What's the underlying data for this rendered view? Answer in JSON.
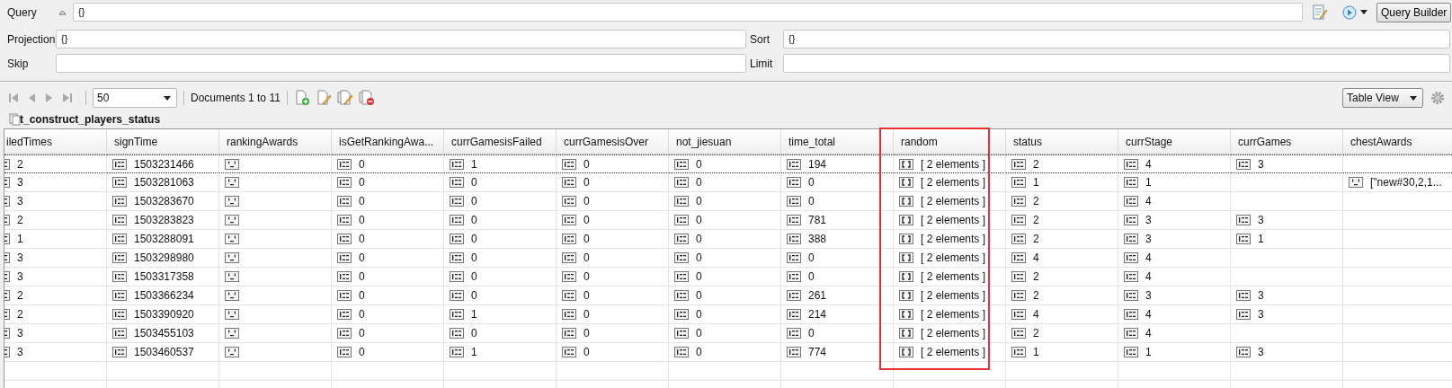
{
  "query": {
    "label": "Query",
    "value": "{}",
    "button": "Query Builder"
  },
  "projection": {
    "label": "Projection",
    "value": "{}"
  },
  "sort": {
    "label": "Sort",
    "value": "{}"
  },
  "skip": {
    "label": "Skip"
  },
  "limit": {
    "label": "Limit"
  },
  "toolbar": {
    "page_size": "50",
    "documents": "Documents 1 to 11",
    "view": "Table View"
  },
  "collection": "t_construct_players_status",
  "columns": [
    {
      "label": "iledTimes",
      "highlighted": false
    },
    {
      "label": "signTime",
      "highlighted": false
    },
    {
      "label": "rankingAwards",
      "highlighted": false
    },
    {
      "label": "isGetRankingAwa...",
      "highlighted": false
    },
    {
      "label": "currGamesisFailed",
      "highlighted": false
    },
    {
      "label": "currGamesisOver",
      "highlighted": false
    },
    {
      "label": "not_jiesuan",
      "highlighted": false
    },
    {
      "label": "time_total",
      "highlighted": false
    },
    {
      "label": "random",
      "highlighted": true
    },
    {
      "label": "status",
      "highlighted": false
    },
    {
      "label": "currStage",
      "highlighted": false
    },
    {
      "label": "currGames",
      "highlighted": false
    },
    {
      "label": "chestAwards",
      "highlighted": false
    }
  ],
  "rows": [
    {
      "selected": true,
      "cells": [
        {
          "kind": "int",
          "text": "2"
        },
        {
          "kind": "int",
          "text": "1503231466"
        },
        {
          "kind": "string"
        },
        {
          "kind": "int",
          "text": "0"
        },
        {
          "kind": "int",
          "text": "1"
        },
        {
          "kind": "int",
          "text": "0"
        },
        {
          "kind": "int",
          "text": "0"
        },
        {
          "kind": "int",
          "text": "194"
        },
        {
          "kind": "array",
          "text": "[ 2 elements ]"
        },
        {
          "kind": "int",
          "text": "2"
        },
        {
          "kind": "int",
          "text": "4"
        },
        {
          "kind": "int",
          "text": "3"
        },
        {
          "kind": "none"
        }
      ]
    },
    {
      "selected": false,
      "cells": [
        {
          "kind": "int",
          "text": "3"
        },
        {
          "kind": "int",
          "text": "1503281063"
        },
        {
          "kind": "string"
        },
        {
          "kind": "int",
          "text": "0"
        },
        {
          "kind": "int",
          "text": "0"
        },
        {
          "kind": "int",
          "text": "0"
        },
        {
          "kind": "int",
          "text": "0"
        },
        {
          "kind": "int",
          "text": "0"
        },
        {
          "kind": "array",
          "text": "[ 2 elements ]"
        },
        {
          "kind": "int",
          "text": "1"
        },
        {
          "kind": "int",
          "text": "1"
        },
        {
          "kind": "none"
        },
        {
          "kind": "string",
          "text": "[\"new#30,2,1..."
        }
      ]
    },
    {
      "selected": false,
      "cells": [
        {
          "kind": "int",
          "text": "3"
        },
        {
          "kind": "int",
          "text": "1503283670"
        },
        {
          "kind": "string"
        },
        {
          "kind": "int",
          "text": "0"
        },
        {
          "kind": "int",
          "text": "0"
        },
        {
          "kind": "int",
          "text": "0"
        },
        {
          "kind": "int",
          "text": "0"
        },
        {
          "kind": "int",
          "text": "0"
        },
        {
          "kind": "array",
          "text": "[ 2 elements ]"
        },
        {
          "kind": "int",
          "text": "2"
        },
        {
          "kind": "int",
          "text": "4"
        },
        {
          "kind": "none"
        },
        {
          "kind": "none"
        }
      ]
    },
    {
      "selected": false,
      "cells": [
        {
          "kind": "int",
          "text": "2"
        },
        {
          "kind": "int",
          "text": "1503283823"
        },
        {
          "kind": "string"
        },
        {
          "kind": "int",
          "text": "0"
        },
        {
          "kind": "int",
          "text": "0"
        },
        {
          "kind": "int",
          "text": "0"
        },
        {
          "kind": "int",
          "text": "0"
        },
        {
          "kind": "int",
          "text": "781"
        },
        {
          "kind": "array",
          "text": "[ 2 elements ]"
        },
        {
          "kind": "int",
          "text": "2"
        },
        {
          "kind": "int",
          "text": "3"
        },
        {
          "kind": "int",
          "text": "3"
        },
        {
          "kind": "none"
        }
      ]
    },
    {
      "selected": false,
      "cells": [
        {
          "kind": "int",
          "text": "1"
        },
        {
          "kind": "int",
          "text": "1503288091"
        },
        {
          "kind": "string"
        },
        {
          "kind": "int",
          "text": "0"
        },
        {
          "kind": "int",
          "text": "0"
        },
        {
          "kind": "int",
          "text": "0"
        },
        {
          "kind": "int",
          "text": "0"
        },
        {
          "kind": "int",
          "text": "388"
        },
        {
          "kind": "array",
          "text": "[ 2 elements ]"
        },
        {
          "kind": "int",
          "text": "2"
        },
        {
          "kind": "int",
          "text": "3"
        },
        {
          "kind": "int",
          "text": "1"
        },
        {
          "kind": "none"
        }
      ]
    },
    {
      "selected": false,
      "cells": [
        {
          "kind": "int",
          "text": "3"
        },
        {
          "kind": "int",
          "text": "1503298980"
        },
        {
          "kind": "string"
        },
        {
          "kind": "int",
          "text": "0"
        },
        {
          "kind": "int",
          "text": "0"
        },
        {
          "kind": "int",
          "text": "0"
        },
        {
          "kind": "int",
          "text": "0"
        },
        {
          "kind": "int",
          "text": "0"
        },
        {
          "kind": "array",
          "text": "[ 2 elements ]"
        },
        {
          "kind": "int",
          "text": "4"
        },
        {
          "kind": "int",
          "text": "4"
        },
        {
          "kind": "none"
        },
        {
          "kind": "none"
        }
      ]
    },
    {
      "selected": false,
      "cells": [
        {
          "kind": "int",
          "text": "3"
        },
        {
          "kind": "int",
          "text": "1503317358"
        },
        {
          "kind": "string"
        },
        {
          "kind": "int",
          "text": "0"
        },
        {
          "kind": "int",
          "text": "0"
        },
        {
          "kind": "int",
          "text": "0"
        },
        {
          "kind": "int",
          "text": "0"
        },
        {
          "kind": "int",
          "text": "0"
        },
        {
          "kind": "array",
          "text": "[ 2 elements ]"
        },
        {
          "kind": "int",
          "text": "2"
        },
        {
          "kind": "int",
          "text": "4"
        },
        {
          "kind": "none"
        },
        {
          "kind": "none"
        }
      ]
    },
    {
      "selected": false,
      "cells": [
        {
          "kind": "int",
          "text": "2"
        },
        {
          "kind": "int",
          "text": "1503366234"
        },
        {
          "kind": "string"
        },
        {
          "kind": "int",
          "text": "0"
        },
        {
          "kind": "int",
          "text": "0"
        },
        {
          "kind": "int",
          "text": "0"
        },
        {
          "kind": "int",
          "text": "0"
        },
        {
          "kind": "int",
          "text": "261"
        },
        {
          "kind": "array",
          "text": "[ 2 elements ]"
        },
        {
          "kind": "int",
          "text": "2"
        },
        {
          "kind": "int",
          "text": "3"
        },
        {
          "kind": "int",
          "text": "3"
        },
        {
          "kind": "none"
        }
      ]
    },
    {
      "selected": false,
      "cells": [
        {
          "kind": "int",
          "text": "2"
        },
        {
          "kind": "int",
          "text": "1503390920"
        },
        {
          "kind": "string"
        },
        {
          "kind": "int",
          "text": "0"
        },
        {
          "kind": "int",
          "text": "1"
        },
        {
          "kind": "int",
          "text": "0"
        },
        {
          "kind": "int",
          "text": "0"
        },
        {
          "kind": "int",
          "text": "214"
        },
        {
          "kind": "array",
          "text": "[ 2 elements ]"
        },
        {
          "kind": "int",
          "text": "4"
        },
        {
          "kind": "int",
          "text": "4"
        },
        {
          "kind": "int",
          "text": "3"
        },
        {
          "kind": "none"
        }
      ]
    },
    {
      "selected": false,
      "cells": [
        {
          "kind": "int",
          "text": "3"
        },
        {
          "kind": "int",
          "text": "1503455103"
        },
        {
          "kind": "string"
        },
        {
          "kind": "int",
          "text": "0"
        },
        {
          "kind": "int",
          "text": "0"
        },
        {
          "kind": "int",
          "text": "0"
        },
        {
          "kind": "int",
          "text": "0"
        },
        {
          "kind": "int",
          "text": "0"
        },
        {
          "kind": "array",
          "text": "[ 2 elements ]"
        },
        {
          "kind": "int",
          "text": "2"
        },
        {
          "kind": "int",
          "text": "4"
        },
        {
          "kind": "none"
        },
        {
          "kind": "none"
        }
      ]
    },
    {
      "selected": false,
      "cells": [
        {
          "kind": "int",
          "text": "3"
        },
        {
          "kind": "int",
          "text": "1503460537"
        },
        {
          "kind": "string"
        },
        {
          "kind": "int",
          "text": "0"
        },
        {
          "kind": "int",
          "text": "1"
        },
        {
          "kind": "int",
          "text": "0"
        },
        {
          "kind": "int",
          "text": "0"
        },
        {
          "kind": "int",
          "text": "774"
        },
        {
          "kind": "array",
          "text": "[ 2 elements ]"
        },
        {
          "kind": "int",
          "text": "1"
        },
        {
          "kind": "int",
          "text": "1"
        },
        {
          "kind": "int",
          "text": "3"
        },
        {
          "kind": "none"
        }
      ]
    }
  ]
}
